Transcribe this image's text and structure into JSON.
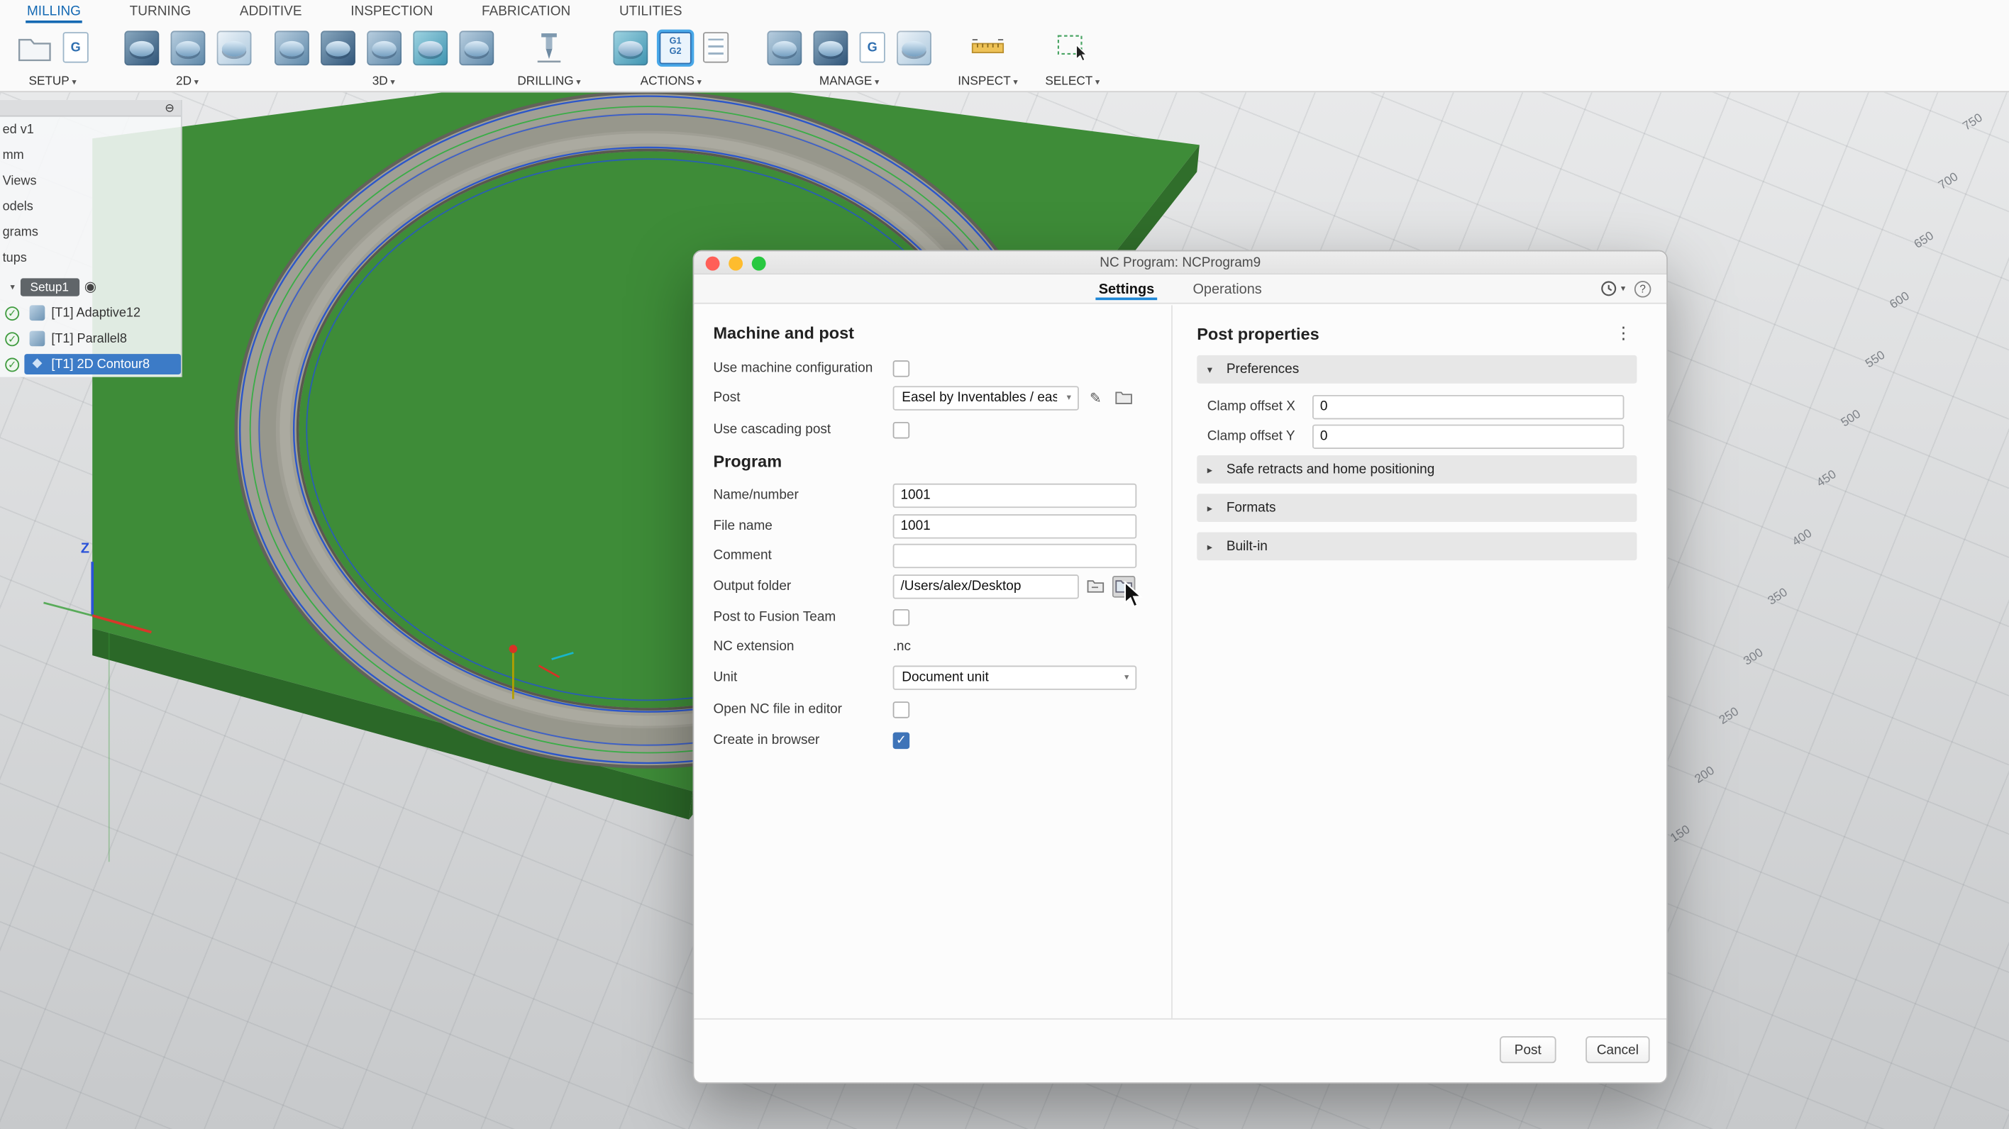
{
  "app": {
    "ribbon_tabs": [
      "MILLING",
      "TURNING",
      "ADDITIVE",
      "INSPECTION",
      "FABRICATION",
      "UTILITIES"
    ],
    "groups": [
      "SETUP",
      "2D",
      "3D",
      "DRILLING",
      "ACTIONS",
      "MANAGE",
      "INSPECT",
      "SELECT"
    ],
    "post_icon": {
      "line1": "G1",
      "line2": "G2"
    },
    "nc_program_icon_letter": "G"
  },
  "browser": {
    "clipped_items": [
      "ed v1",
      "mm",
      "Views",
      "odels",
      "grams",
      "tups"
    ],
    "setup_label": "Setup1",
    "operations": [
      {
        "label": "[T1] Adaptive12"
      },
      {
        "label": "[T1] Parallel8"
      },
      {
        "label": "[T1] 2D Contour8"
      }
    ]
  },
  "viewport": {
    "axis_z": "Z",
    "ruler_labels": [
      "750",
      "700",
      "650",
      "600",
      "550",
      "500",
      "450",
      "400",
      "350",
      "300",
      "250",
      "200",
      "150"
    ]
  },
  "dialog": {
    "title": "NC Program: NCProgram9",
    "tabs": [
      "Settings",
      "Operations"
    ],
    "machine": {
      "heading": "Machine and post",
      "use_machine_configuration": "Use machine configuration",
      "post": "Post",
      "post_value": "Easel by Inventables / eas",
      "use_cascading_post": "Use cascading post"
    },
    "program": {
      "heading": "Program",
      "name_label": "Name/number",
      "name_value": "1001",
      "file_label": "File name",
      "file_value": "1001",
      "comment_label": "Comment",
      "comment_value": "",
      "output_label": "Output folder",
      "output_value": "/Users/alex/Desktop",
      "team_label": "Post to Fusion Team",
      "ncext_label": "NC extension",
      "ncext_value": ".nc",
      "unit_label": "Unit",
      "unit_value": "Document unit",
      "open_editor_label": "Open NC file in editor",
      "create_browser_label": "Create in browser"
    },
    "post_properties": {
      "heading": "Post properties",
      "preferences": "Preferences",
      "clamp_x_label": "Clamp offset X",
      "clamp_x_value": "0",
      "clamp_y_label": "Clamp offset Y",
      "clamp_y_value": "0",
      "safe_retracts": "Safe retracts and home positioning",
      "formats": "Formats",
      "builtin": "Built-in"
    },
    "buttons": {
      "post": "Post",
      "cancel": "Cancel"
    }
  },
  "icons": {
    "chevron_down": "▾",
    "tri_right": "▸",
    "tri_down": "▾",
    "kebab": "⋮",
    "help": "?",
    "check": "✓",
    "pencil": "✎",
    "collapse": "⊖",
    "target": "◉",
    "diamond": "◆"
  },
  "colors": {
    "accent": "#1d87d7",
    "selection": "#3c7bc7",
    "board_green": "#3e8c38",
    "checkbox_on": "#3f74b8",
    "traffic_red": "#ff5f57",
    "traffic_yellow": "#febc2e",
    "traffic_green": "#28c840"
  }
}
